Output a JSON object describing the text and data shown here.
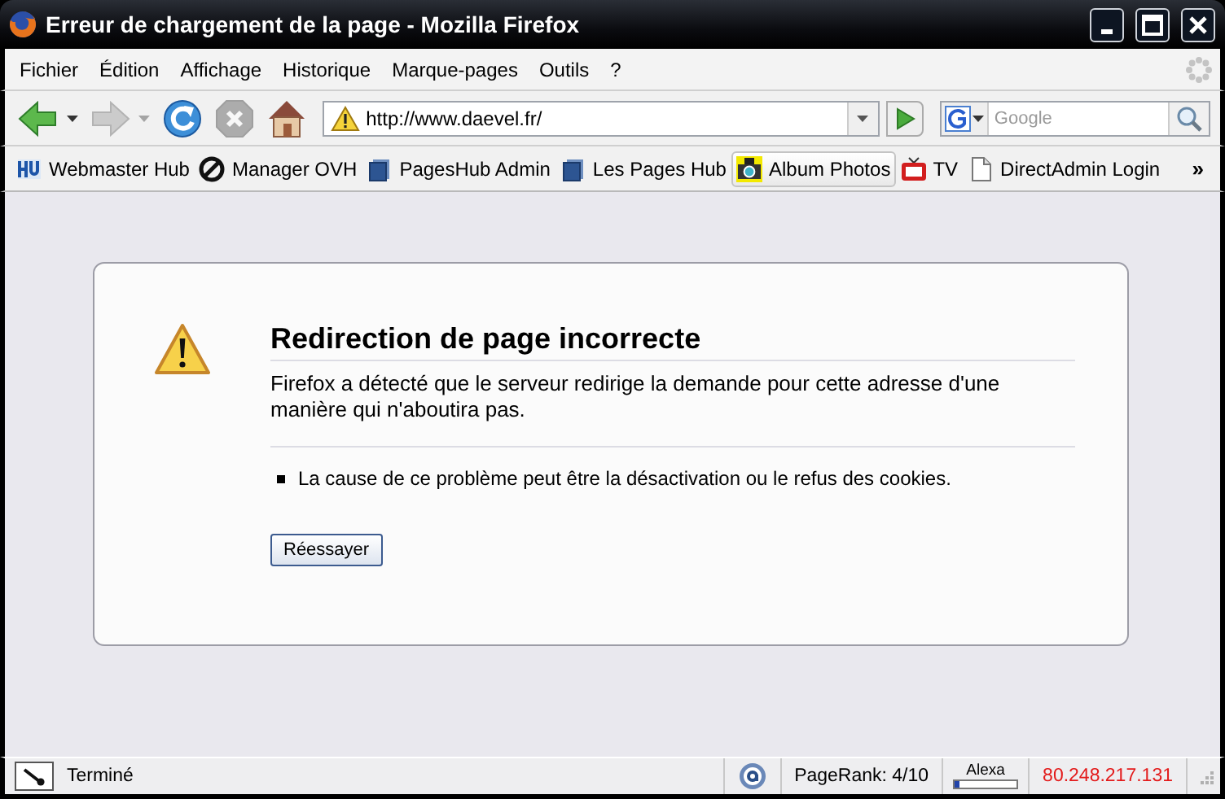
{
  "window": {
    "title": "Erreur de chargement de la page - Mozilla Firefox"
  },
  "menu": [
    "Fichier",
    "Édition",
    "Affichage",
    "Historique",
    "Marque-pages",
    "Outils",
    "?"
  ],
  "toolbar_buttons": [
    {
      "kind": "back",
      "disabled": false
    },
    {
      "kind": "forward",
      "disabled": true
    },
    {
      "kind": "reload",
      "disabled": false
    },
    {
      "kind": "stop",
      "disabled": true
    },
    {
      "kind": "home",
      "disabled": false
    }
  ],
  "address": {
    "value": "http://www.daevel.fr/"
  },
  "search": {
    "placeholder": "Google"
  },
  "bookmarks": [
    {
      "label": "Webmaster Hub",
      "kind": "hub",
      "selected": false
    },
    {
      "label": "Manager OVH",
      "kind": "swirl",
      "selected": false
    },
    {
      "label": "PagesHub Admin",
      "kind": "folder",
      "selected": false
    },
    {
      "label": "Les Pages Hub",
      "kind": "folder",
      "selected": false
    },
    {
      "label": "Album Photos",
      "kind": "camera",
      "selected": true
    },
    {
      "label": "TV",
      "kind": "tv",
      "selected": false
    },
    {
      "label": "DirectAdmin Login",
      "kind": "page",
      "selected": false
    }
  ],
  "bookmarks_overflow": "»",
  "error": {
    "title": "Redirection de page incorrecte",
    "description": "Firefox a détecté que le serveur redirige la demande pour cette adresse d'une manière qui n'aboutira pas.",
    "items": [
      "La cause de ce problème peut être la désactivation ou le refus des cookies."
    ],
    "button": "Réessayer"
  },
  "status_bar": {
    "text": "Terminé",
    "pagerank": "PageRank: 4/10",
    "alexa": {
      "label": "Alexa",
      "level": 0.08
    },
    "ip": "80.248.217.131"
  }
}
